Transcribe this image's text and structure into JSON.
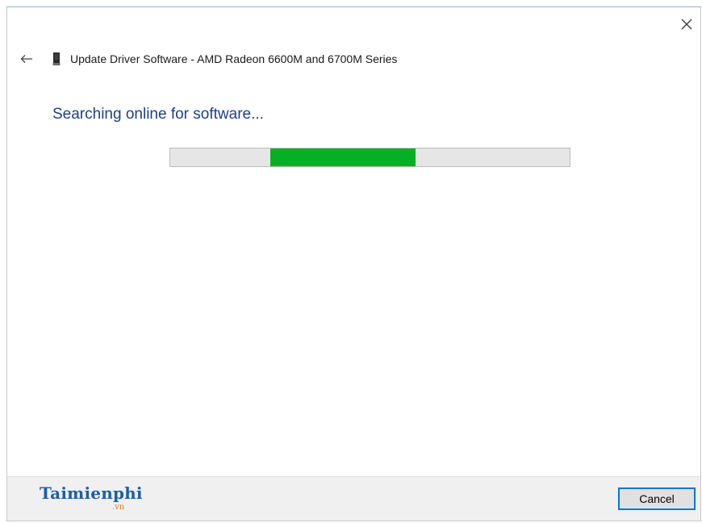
{
  "window": {
    "close_icon": "close-icon",
    "back_icon": "back-arrow-icon",
    "device_icon": "graphics-card-icon",
    "title": "Update Driver Software - AMD Radeon 6600M and 6700M Series"
  },
  "main": {
    "instruction": "Searching online for software...",
    "progress": {
      "mode": "indeterminate",
      "chunk_start_fraction": 0.25,
      "chunk_end_fraction": 0.615,
      "color": "#06b025"
    }
  },
  "footer": {
    "logo_text": "Taimienphi",
    "logo_suffix": ".vn",
    "cancel_label": "Cancel"
  },
  "colors": {
    "instruction_text": "#1e3f8a",
    "button_border": "#0078d7",
    "footer_bg": "#f0f0f0"
  }
}
